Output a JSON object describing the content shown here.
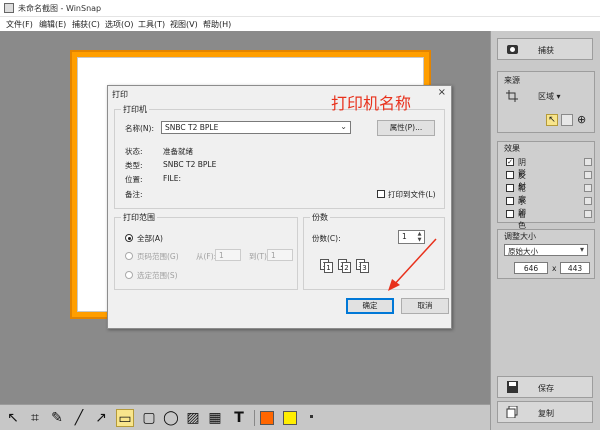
{
  "window": {
    "title": "未命名截图 - WinSnap"
  },
  "menu": [
    "文件(F)",
    "编辑(E)",
    "捕获(C)",
    "选项(O)",
    "工具(T)",
    "视图(V)",
    "帮助(H)"
  ],
  "dialog": {
    "title": "打印",
    "close": "×",
    "annotation": "打印机名称",
    "printer_group": "打印机",
    "name_label": "名称(N):",
    "printer_name": "SNBC T2 BPLE",
    "properties_btn": "属性(P)...",
    "status_label": "状态:",
    "status_value": "准备就绪",
    "type_label": "类型:",
    "type_value": "SNBC T2 BPLE",
    "where_label": "位置:",
    "where_value": "FILE:",
    "comment_label": "备注:",
    "print_to_file": "打印到文件(L)",
    "range_group": "打印范围",
    "range_all": "全部(A)",
    "range_pages": "页码范围(G)",
    "from_label": "从(F):",
    "from_value": "1",
    "to_label": "到(T):",
    "to_value": "1",
    "range_selection": "选定范围(S)",
    "copies_group": "份数",
    "copies_label": "份数(C):",
    "copies_value": "1",
    "collate_pages": [
      "1",
      "1",
      "2",
      "2",
      "3",
      "3"
    ],
    "ok": "确定",
    "cancel": "取消"
  },
  "right_panel": {
    "capture_btn": "捕获",
    "source_title": "来源",
    "source_value": "区域",
    "effects_title": "效果",
    "effects": [
      {
        "label": "阴影",
        "checked": true
      },
      {
        "label": "反射",
        "checked": false
      },
      {
        "label": "轮廓",
        "checked": false
      },
      {
        "label": "水印",
        "checked": false
      },
      {
        "label": "着色",
        "checked": false
      }
    ],
    "resize_title": "调整大小",
    "resize_value": "原始大小",
    "width": "646",
    "times": "x",
    "height": "443",
    "save_btn": "保存",
    "copy_btn": "复制"
  },
  "colors": {
    "accent_orange": "#ff6600",
    "accent_yellow": "#ffee00",
    "annotation_red": "#e8311c"
  }
}
